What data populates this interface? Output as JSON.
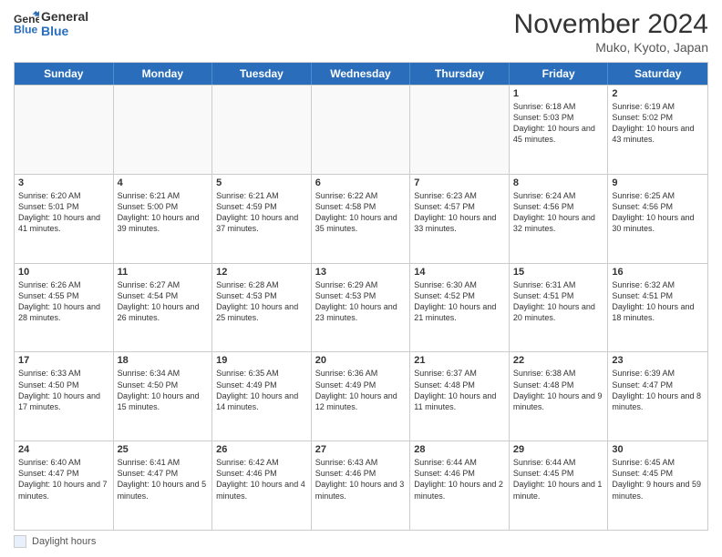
{
  "header": {
    "logo_line1": "General",
    "logo_line2": "Blue",
    "month": "November 2024",
    "location": "Muko, Kyoto, Japan"
  },
  "weekdays": [
    "Sunday",
    "Monday",
    "Tuesday",
    "Wednesday",
    "Thursday",
    "Friday",
    "Saturday"
  ],
  "footer": {
    "legend_label": "Daylight hours"
  },
  "weeks": [
    [
      {
        "day": "",
        "info": ""
      },
      {
        "day": "",
        "info": ""
      },
      {
        "day": "",
        "info": ""
      },
      {
        "day": "",
        "info": ""
      },
      {
        "day": "",
        "info": ""
      },
      {
        "day": "1",
        "info": "Sunrise: 6:18 AM\nSunset: 5:03 PM\nDaylight: 10 hours and 45 minutes."
      },
      {
        "day": "2",
        "info": "Sunrise: 6:19 AM\nSunset: 5:02 PM\nDaylight: 10 hours and 43 minutes."
      }
    ],
    [
      {
        "day": "3",
        "info": "Sunrise: 6:20 AM\nSunset: 5:01 PM\nDaylight: 10 hours and 41 minutes."
      },
      {
        "day": "4",
        "info": "Sunrise: 6:21 AM\nSunset: 5:00 PM\nDaylight: 10 hours and 39 minutes."
      },
      {
        "day": "5",
        "info": "Sunrise: 6:21 AM\nSunset: 4:59 PM\nDaylight: 10 hours and 37 minutes."
      },
      {
        "day": "6",
        "info": "Sunrise: 6:22 AM\nSunset: 4:58 PM\nDaylight: 10 hours and 35 minutes."
      },
      {
        "day": "7",
        "info": "Sunrise: 6:23 AM\nSunset: 4:57 PM\nDaylight: 10 hours and 33 minutes."
      },
      {
        "day": "8",
        "info": "Sunrise: 6:24 AM\nSunset: 4:56 PM\nDaylight: 10 hours and 32 minutes."
      },
      {
        "day": "9",
        "info": "Sunrise: 6:25 AM\nSunset: 4:56 PM\nDaylight: 10 hours and 30 minutes."
      }
    ],
    [
      {
        "day": "10",
        "info": "Sunrise: 6:26 AM\nSunset: 4:55 PM\nDaylight: 10 hours and 28 minutes."
      },
      {
        "day": "11",
        "info": "Sunrise: 6:27 AM\nSunset: 4:54 PM\nDaylight: 10 hours and 26 minutes."
      },
      {
        "day": "12",
        "info": "Sunrise: 6:28 AM\nSunset: 4:53 PM\nDaylight: 10 hours and 25 minutes."
      },
      {
        "day": "13",
        "info": "Sunrise: 6:29 AM\nSunset: 4:53 PM\nDaylight: 10 hours and 23 minutes."
      },
      {
        "day": "14",
        "info": "Sunrise: 6:30 AM\nSunset: 4:52 PM\nDaylight: 10 hours and 21 minutes."
      },
      {
        "day": "15",
        "info": "Sunrise: 6:31 AM\nSunset: 4:51 PM\nDaylight: 10 hours and 20 minutes."
      },
      {
        "day": "16",
        "info": "Sunrise: 6:32 AM\nSunset: 4:51 PM\nDaylight: 10 hours and 18 minutes."
      }
    ],
    [
      {
        "day": "17",
        "info": "Sunrise: 6:33 AM\nSunset: 4:50 PM\nDaylight: 10 hours and 17 minutes."
      },
      {
        "day": "18",
        "info": "Sunrise: 6:34 AM\nSunset: 4:50 PM\nDaylight: 10 hours and 15 minutes."
      },
      {
        "day": "19",
        "info": "Sunrise: 6:35 AM\nSunset: 4:49 PM\nDaylight: 10 hours and 14 minutes."
      },
      {
        "day": "20",
        "info": "Sunrise: 6:36 AM\nSunset: 4:49 PM\nDaylight: 10 hours and 12 minutes."
      },
      {
        "day": "21",
        "info": "Sunrise: 6:37 AM\nSunset: 4:48 PM\nDaylight: 10 hours and 11 minutes."
      },
      {
        "day": "22",
        "info": "Sunrise: 6:38 AM\nSunset: 4:48 PM\nDaylight: 10 hours and 9 minutes."
      },
      {
        "day": "23",
        "info": "Sunrise: 6:39 AM\nSunset: 4:47 PM\nDaylight: 10 hours and 8 minutes."
      }
    ],
    [
      {
        "day": "24",
        "info": "Sunrise: 6:40 AM\nSunset: 4:47 PM\nDaylight: 10 hours and 7 minutes."
      },
      {
        "day": "25",
        "info": "Sunrise: 6:41 AM\nSunset: 4:47 PM\nDaylight: 10 hours and 5 minutes."
      },
      {
        "day": "26",
        "info": "Sunrise: 6:42 AM\nSunset: 4:46 PM\nDaylight: 10 hours and 4 minutes."
      },
      {
        "day": "27",
        "info": "Sunrise: 6:43 AM\nSunset: 4:46 PM\nDaylight: 10 hours and 3 minutes."
      },
      {
        "day": "28",
        "info": "Sunrise: 6:44 AM\nSunset: 4:46 PM\nDaylight: 10 hours and 2 minutes."
      },
      {
        "day": "29",
        "info": "Sunrise: 6:44 AM\nSunset: 4:45 PM\nDaylight: 10 hours and 1 minute."
      },
      {
        "day": "30",
        "info": "Sunrise: 6:45 AM\nSunset: 4:45 PM\nDaylight: 9 hours and 59 minutes."
      }
    ]
  ]
}
